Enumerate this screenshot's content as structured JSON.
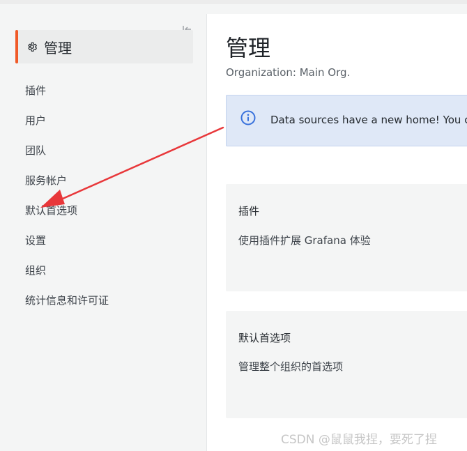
{
  "sidebar": {
    "section_title": "管理",
    "section_icon": "gear-icon",
    "collapse_icon": "collapse-sidebar-icon",
    "accent_color": "#f05a28",
    "items": [
      {
        "label": "插件"
      },
      {
        "label": "用户"
      },
      {
        "label": "团队"
      },
      {
        "label": "服务帐户"
      },
      {
        "label": "默认首选项"
      },
      {
        "label": "设置"
      },
      {
        "label": "组织"
      },
      {
        "label": "统计信息和许可证"
      }
    ]
  },
  "main": {
    "title": "管理",
    "subtitle": "Organization: Main Org.",
    "alert": {
      "icon": "info-circle-icon",
      "text": "Data sources have a new home! You can now find them in Connections.",
      "color": "#3871dc"
    },
    "cards": [
      {
        "title": "插件",
        "description": "使用插件扩展 Grafana 体验"
      },
      {
        "title": "默认首选项",
        "description": "管理整个组织的首选项"
      }
    ]
  },
  "annotation": {
    "arrow_color": "#e8373a"
  },
  "watermark": "CSDN @鼠鼠我捏，要死了捏"
}
